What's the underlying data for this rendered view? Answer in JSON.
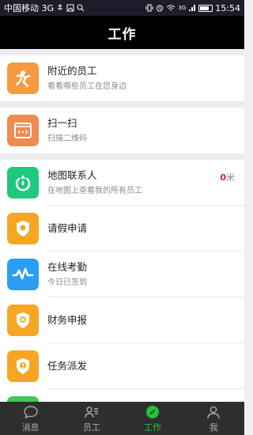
{
  "status_bar": {
    "carrier": "中国移动 3G",
    "network_label": "3G",
    "time": "15:54"
  },
  "header": {
    "title": "工作"
  },
  "items": [
    {
      "title": "附近的员工",
      "subtitle": "看看哪些员工在您身边",
      "icon": "person-running-icon",
      "color": "#f59a3e"
    },
    {
      "title": "扫一扫",
      "subtitle": "扫描二维码",
      "icon": "scan-frame-icon",
      "color": "#ef8b4f"
    },
    {
      "title": "地图联系人",
      "subtitle": "在地图上查看我的所有员工",
      "icon": "location-refresh-icon",
      "color": "#1ec97d",
      "distance_value": "0",
      "distance_unit": "米"
    },
    {
      "title": "请假申请",
      "subtitle": "",
      "icon": "shield-leave-icon",
      "color": "#f5a623"
    },
    {
      "title": "在线考勤",
      "subtitle": "今日已签到",
      "icon": "pulse-wave-icon",
      "color": "#2a9df4"
    },
    {
      "title": "财务申报",
      "subtitle": "",
      "icon": "shield-finance-icon",
      "color": "#f5a623"
    },
    {
      "title": "任务派发",
      "subtitle": "",
      "icon": "shield-task-icon",
      "color": "#f5a623"
    }
  ],
  "tabbar": {
    "tabs": [
      {
        "label": "消息",
        "icon": "chat-bubble-icon"
      },
      {
        "label": "员工",
        "icon": "contacts-icon"
      },
      {
        "label": "工作",
        "icon": "compass-icon",
        "active": true
      },
      {
        "label": "我",
        "icon": "user-icon"
      }
    ]
  }
}
